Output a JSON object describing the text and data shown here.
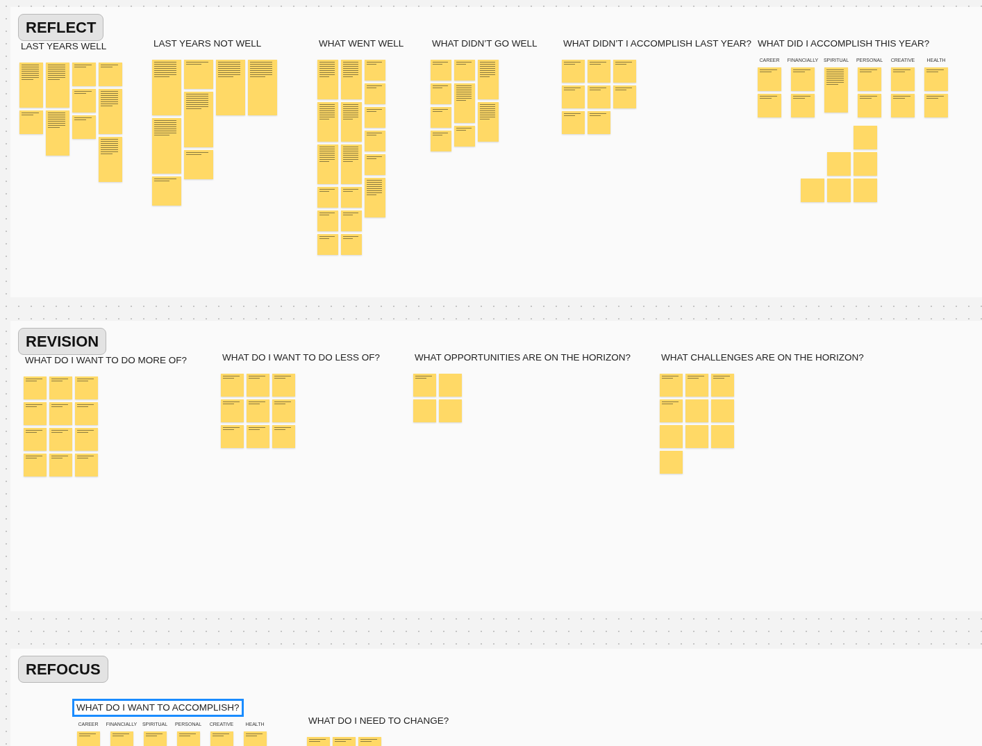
{
  "sections": [
    {
      "label": "REFLECT",
      "columns": [
        {
          "title": "LAST YEARS WELL",
          "stacks": [
            [
              {
                "tall": true,
                "blank": false
              },
              {
                "tall": false,
                "blank": false
              }
            ],
            [
              {
                "tall": true,
                "blank": false
              },
              {
                "tall": true,
                "blank": false
              }
            ],
            [
              {
                "tall": false,
                "blank": false
              },
              {
                "tall": false,
                "blank": false
              },
              {
                "tall": false,
                "blank": false
              }
            ],
            [
              {
                "tall": false,
                "blank": false
              },
              {
                "tall": true,
                "blank": false
              },
              {
                "tall": true,
                "blank": false
              }
            ]
          ]
        },
        {
          "title": "LAST YEARS NOT WELL",
          "stacks": [
            [
              {
                "tall": true,
                "blank": false
              },
              {
                "tall": true,
                "blank": false
              },
              {
                "tall": false,
                "blank": false
              }
            ],
            [
              {
                "tall": false,
                "blank": false
              },
              {
                "tall": true,
                "blank": false
              },
              {
                "tall": false,
                "blank": false
              }
            ],
            [
              {
                "tall": true,
                "blank": false
              }
            ],
            [
              {
                "tall": true,
                "blank": false
              }
            ]
          ]
        },
        {
          "title": "WHAT WENT WELL",
          "stacks": [
            [
              {
                "tall": true,
                "blank": false
              },
              {
                "tall": true,
                "blank": false
              },
              {
                "tall": true,
                "blank": false
              },
              {
                "tall": false,
                "blank": false
              },
              {
                "tall": false,
                "blank": false
              },
              {
                "tall": false,
                "blank": false
              }
            ],
            [
              {
                "tall": true,
                "blank": false
              },
              {
                "tall": true,
                "blank": false
              },
              {
                "tall": true,
                "blank": false
              },
              {
                "tall": false,
                "blank": false
              },
              {
                "tall": false,
                "blank": false
              },
              {
                "tall": false,
                "blank": false
              }
            ],
            [
              {
                "tall": false,
                "blank": false
              },
              {
                "tall": false,
                "blank": false
              },
              {
                "tall": false,
                "blank": false
              },
              {
                "tall": false,
                "blank": false
              },
              {
                "tall": false,
                "blank": false
              },
              {
                "tall": true,
                "blank": false
              }
            ]
          ]
        },
        {
          "title": "WHAT DIDN’T GO WELL",
          "stacks": [
            [
              {
                "tall": false,
                "blank": false
              },
              {
                "tall": false,
                "blank": false
              },
              {
                "tall": false,
                "blank": false
              },
              {
                "tall": false,
                "blank": false
              }
            ],
            [
              {
                "tall": false,
                "blank": false
              },
              {
                "tall": true,
                "blank": false
              },
              {
                "tall": false,
                "blank": false
              }
            ],
            [
              {
                "tall": true,
                "blank": false
              },
              {
                "tall": true,
                "blank": false
              }
            ]
          ]
        },
        {
          "title": "WHAT DIDN’T I ACCOMPLISH LAST YEAR?",
          "stacks": [
            [
              {
                "tall": false,
                "blank": false
              },
              {
                "tall": false,
                "blank": false
              },
              {
                "tall": false,
                "blank": false
              }
            ],
            [
              {
                "tall": false,
                "blank": false
              },
              {
                "tall": false,
                "blank": false
              },
              {
                "tall": false,
                "blank": false
              }
            ],
            [
              {
                "tall": false,
                "blank": false
              },
              {
                "tall": false,
                "blank": false
              }
            ]
          ]
        },
        {
          "title": "WHAT DID I ACCOMPLISH THIS YEAR?",
          "categories": [
            {
              "label": "CAREER",
              "notes": [
                {
                  "tall": false,
                  "blank": false
                },
                {
                  "tall": false,
                  "blank": false
                }
              ]
            },
            {
              "label": "FINANCIALLY",
              "notes": [
                {
                  "tall": false,
                  "blank": false
                },
                {
                  "tall": false,
                  "blank": false
                }
              ]
            },
            {
              "label": "SPIRITUAL",
              "notes": [
                {
                  "tall": true,
                  "blank": false
                }
              ]
            },
            {
              "label": "PERSONAL",
              "notes": [
                {
                  "tall": false,
                  "blank": false
                },
                {
                  "tall": false,
                  "blank": false
                }
              ]
            },
            {
              "label": "CREATIVE",
              "notes": [
                {
                  "tall": false,
                  "blank": false
                },
                {
                  "tall": false,
                  "blank": false
                }
              ]
            },
            {
              "label": "HEALTH",
              "notes": [
                {
                  "tall": false,
                  "blank": false
                },
                {
                  "tall": false,
                  "blank": false
                }
              ]
            }
          ],
          "stacks": [
            [
              {
                "tall": false,
                "blank": true
              }
            ],
            [
              {
                "tall": false,
                "blank": true
              },
              {
                "tall": false,
                "blank": true
              }
            ],
            [
              {
                "tall": false,
                "blank": true
              },
              {
                "tall": false,
                "blank": true
              },
              {
                "tall": false,
                "blank": true
              }
            ]
          ]
        }
      ]
    },
    {
      "label": "REVISION",
      "columns": [
        {
          "title": "WHAT DO I WANT TO DO MORE OF?",
          "stacks": [
            [
              {
                "tall": false,
                "blank": false
              },
              {
                "tall": false,
                "blank": false
              },
              {
                "tall": false,
                "blank": false
              },
              {
                "tall": false,
                "blank": false
              }
            ],
            [
              {
                "tall": false,
                "blank": false
              },
              {
                "tall": false,
                "blank": false
              },
              {
                "tall": false,
                "blank": false
              },
              {
                "tall": false,
                "blank": false
              }
            ],
            [
              {
                "tall": false,
                "blank": false
              },
              {
                "tall": false,
                "blank": false
              },
              {
                "tall": false,
                "blank": false
              },
              {
                "tall": false,
                "blank": false
              }
            ]
          ]
        },
        {
          "title": "WHAT DO I WANT TO DO LESS OF?",
          "stacks": [
            [
              {
                "tall": false,
                "blank": false
              },
              {
                "tall": false,
                "blank": false
              },
              {
                "tall": false,
                "blank": false
              }
            ],
            [
              {
                "tall": false,
                "blank": false
              },
              {
                "tall": false,
                "blank": false
              },
              {
                "tall": false,
                "blank": false
              }
            ],
            [
              {
                "tall": false,
                "blank": false
              },
              {
                "tall": false,
                "blank": false
              },
              {
                "tall": false,
                "blank": false
              }
            ]
          ]
        },
        {
          "title": "WHAT OPPORTUNITIES ARE ON THE HORIZON?",
          "stacks": [
            [
              {
                "tall": false,
                "blank": false
              },
              {
                "tall": false,
                "blank": true
              }
            ],
            [
              {
                "tall": false,
                "blank": true
              },
              {
                "tall": false,
                "blank": true
              }
            ]
          ]
        },
        {
          "title": "WHAT CHALLENGES ARE ON THE HORIZON?",
          "stacks": [
            [
              {
                "tall": false,
                "blank": false
              },
              {
                "tall": false,
                "blank": false
              },
              {
                "tall": false,
                "blank": true
              },
              {
                "tall": false,
                "blank": true
              }
            ],
            [
              {
                "tall": false,
                "blank": false
              },
              {
                "tall": false,
                "blank": true
              },
              {
                "tall": false,
                "blank": true
              }
            ],
            [
              {
                "tall": false,
                "blank": false
              },
              {
                "tall": false,
                "blank": true
              },
              {
                "tall": false,
                "blank": true
              }
            ]
          ]
        }
      ]
    },
    {
      "label": "REFOCUS",
      "columns": [
        {
          "title": "WHAT DO I WANT TO ACCOMPLISH?",
          "selected": true,
          "categories": [
            {
              "label": "CAREER",
              "notes": [
                {
                  "tall": false,
                  "blank": false
                }
              ]
            },
            {
              "label": "FINANCIALLY",
              "notes": [
                {
                  "tall": false,
                  "blank": false
                }
              ]
            },
            {
              "label": "SPIRITUAL",
              "notes": [
                {
                  "tall": false,
                  "blank": false
                }
              ]
            },
            {
              "label": "PERSONAL",
              "notes": [
                {
                  "tall": false,
                  "blank": false
                }
              ]
            },
            {
              "label": "CREATIVE",
              "notes": [
                {
                  "tall": false,
                  "blank": false
                }
              ]
            },
            {
              "label": "HEALTH",
              "notes": [
                {
                  "tall": false,
                  "blank": false
                }
              ]
            }
          ]
        },
        {
          "title": "WHAT DO I NEED TO CHANGE?",
          "selected": false,
          "stacks": [
            [
              {
                "tall": false,
                "blank": false
              }
            ],
            [
              {
                "tall": false,
                "blank": false
              }
            ],
            [
              {
                "tall": false,
                "blank": false
              }
            ]
          ]
        }
      ]
    }
  ]
}
